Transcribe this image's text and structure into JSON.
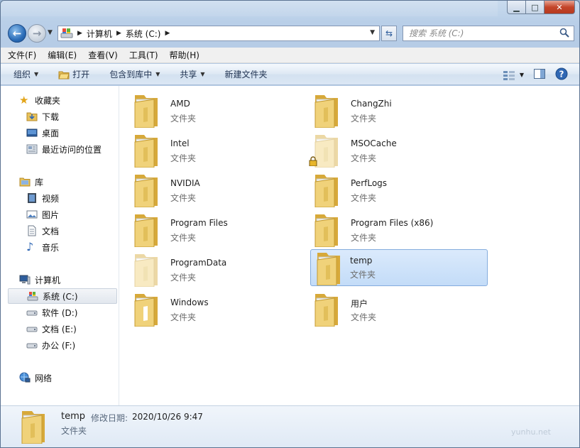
{
  "window": {
    "caption": {
      "minimize": "▁",
      "maximize": "□",
      "close": "✕"
    }
  },
  "address": {
    "crumbs": [
      "计算机",
      "系统 (C:)"
    ],
    "search_placeholder": "搜索 系统 (C:)"
  },
  "menu": [
    "文件(F)",
    "编辑(E)",
    "查看(V)",
    "工具(T)",
    "帮助(H)"
  ],
  "commands": [
    {
      "label": "组织",
      "dropdown": true,
      "icon": ""
    },
    {
      "label": "打开",
      "dropdown": false,
      "icon": "open-folder-icon"
    },
    {
      "label": "包含到库中",
      "dropdown": true,
      "icon": ""
    },
    {
      "label": "共享",
      "dropdown": true,
      "icon": ""
    },
    {
      "label": "新建文件夹",
      "dropdown": false,
      "icon": ""
    }
  ],
  "nav": {
    "favorites": {
      "label": "收藏夹",
      "items": [
        "下载",
        "桌面",
        "最近访问的位置"
      ]
    },
    "libraries": {
      "label": "库",
      "items": [
        "视频",
        "图片",
        "文档",
        "音乐"
      ]
    },
    "computer": {
      "label": "计算机",
      "items": [
        "系统 (C:)",
        "软件 (D:)",
        "文档 (E:)",
        "办公 (F:)"
      ],
      "selected": "系统 (C:)"
    },
    "network": {
      "label": "网络"
    }
  },
  "folders": [
    {
      "name": "AMD",
      "type": "文件夹",
      "style": "normal"
    },
    {
      "name": "ChangZhi",
      "type": "文件夹",
      "style": "normal"
    },
    {
      "name": "Intel",
      "type": "文件夹",
      "style": "normal"
    },
    {
      "name": "MSOCache",
      "type": "文件夹",
      "style": "hidden-locked"
    },
    {
      "name": "NVIDIA",
      "type": "文件夹",
      "style": "normal"
    },
    {
      "name": "PerfLogs",
      "type": "文件夹",
      "style": "normal"
    },
    {
      "name": "Program Files",
      "type": "文件夹",
      "style": "normal"
    },
    {
      "name": "Program Files (x86)",
      "type": "文件夹",
      "style": "normal"
    },
    {
      "name": "ProgramData",
      "type": "文件夹",
      "style": "hidden"
    },
    {
      "name": "temp",
      "type": "文件夹",
      "style": "selected"
    },
    {
      "name": "Windows",
      "type": "文件夹",
      "style": "normal-white"
    },
    {
      "name": "用户",
      "type": "文件夹",
      "style": "normal"
    }
  ],
  "details": {
    "name": "temp",
    "modified_label": "修改日期:",
    "modified_value": "2020/10/26 9:47",
    "type": "文件夹"
  },
  "watermark": "yunhu.net",
  "colors": {
    "selection": "#c3dcf8",
    "folder": "#e8c867",
    "accent": "#2b6db8"
  }
}
